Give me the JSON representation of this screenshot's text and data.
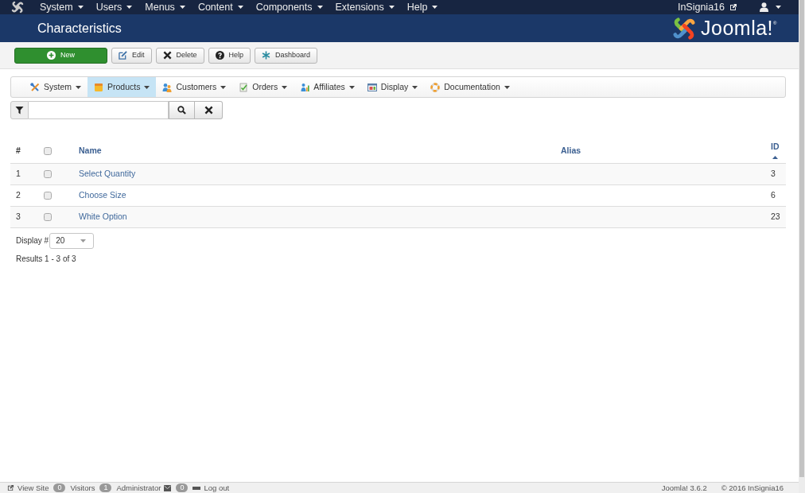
{
  "top_menu": {
    "items": [
      {
        "label": "System"
      },
      {
        "label": "Users"
      },
      {
        "label": "Menus"
      },
      {
        "label": "Content"
      },
      {
        "label": "Components"
      },
      {
        "label": "Extensions"
      },
      {
        "label": "Help"
      }
    ],
    "site_link": "InSignia16"
  },
  "header": {
    "title": "Characteristics",
    "logo": "Joomla!$^{®}$"
  },
  "toolbar": [
    {
      "label": "New",
      "kind": "success"
    },
    {
      "label": "Edit",
      "kind": "default"
    },
    {
      "label": "Delete",
      "kind": "default"
    },
    {
      "label": "Help",
      "kind": "default"
    },
    {
      "label": "Dashboard",
      "kind": "default"
    }
  ],
  "submenu": [
    {
      "label": "System",
      "selected": false
    },
    {
      "label": "Products",
      "selected": true
    },
    {
      "label": "Customers",
      "selected": false
    },
    {
      "label": "Orders",
      "selected": false
    },
    {
      "label": "Affiliates",
      "selected": false
    },
    {
      "label": "Display",
      "selected": false
    },
    {
      "label": "Documentation",
      "selected": false
    }
  ],
  "table": {
    "columns": [
      {
        "label": "#",
        "sortable": false,
        "sorted": false
      },
      {
        "label": "Name",
        "sortable": true,
        "sorted": false
      },
      {
        "label": "Alias",
        "sortable": true,
        "sorted": false
      },
      {
        "label": "ID",
        "sortable": true,
        "sorted": true
      }
    ],
    "select_all": {
      "checked": false
    },
    "rows": [
      {
        "number": "1",
        "checked": false,
        "name": "Select Quantity",
        "id": "3"
      },
      {
        "number": "2",
        "checked": false,
        "name": "Choose Size",
        "id": "6"
      },
      {
        "number": "3",
        "checked": false,
        "name": "White Option",
        "id": "23"
      }
    ]
  },
  "pagination": {
    "label": "Display #",
    "limit": "20",
    "results": "Results 1 - 3 of 3"
  },
  "status_bar": {
    "items": [
      {
        "kind": "view_site",
        "label": "View Site"
      },
      {
        "kind": "counter",
        "count": "0",
        "label": "Visitors"
      },
      {
        "kind": "counter",
        "count": "1",
        "label": "Administrator"
      },
      {
        "kind": "messages",
        "count": "0"
      },
      {
        "kind": "logout",
        "label": "Log out"
      }
    ],
    "version": "Joomla! 3.6.2",
    "copyright": "© 2016 InSignia16"
  }
}
